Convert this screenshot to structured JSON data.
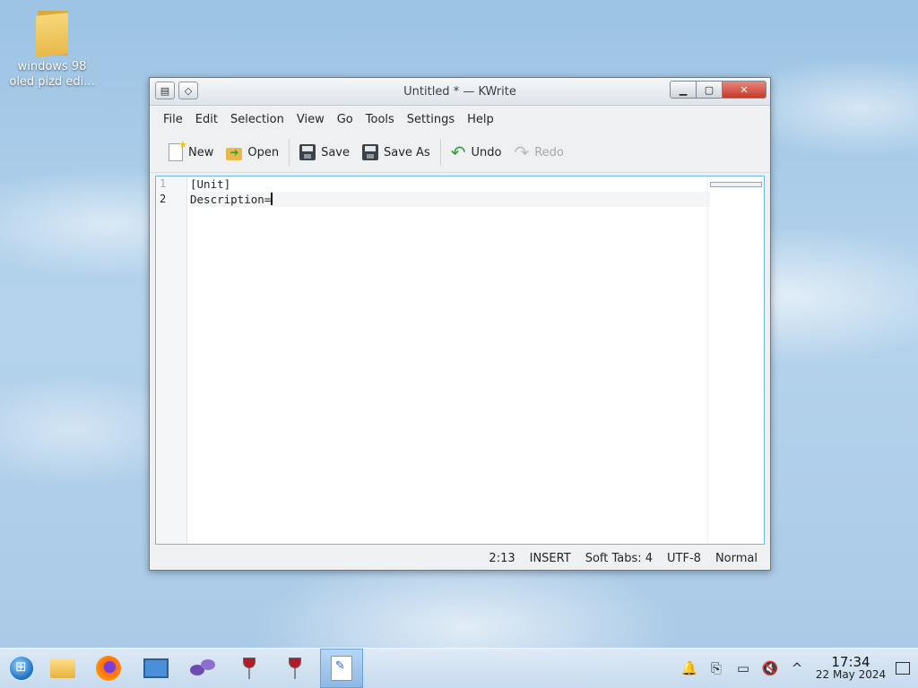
{
  "desktop": {
    "icon_label": "windows 98\noled pizd edi...",
    "icon_label_line1": "windows 98",
    "icon_label_line2": "oled pizd edi...",
    "icon": "folder-icon"
  },
  "window": {
    "title": "Untitled * — KWrite",
    "menu": [
      "File",
      "Edit",
      "Selection",
      "View",
      "Go",
      "Tools",
      "Settings",
      "Help"
    ],
    "toolbar": {
      "new": "New",
      "open": "Open",
      "save": "Save",
      "save_as": "Save As",
      "undo": "Undo",
      "redo": "Redo"
    },
    "editor": {
      "line_numbers": [
        "1",
        "2"
      ],
      "lines": [
        "[Unit]",
        "Description="
      ],
      "current_line": 2
    },
    "status": {
      "position": "2:13",
      "mode": "INSERT",
      "indent": "Soft Tabs: 4",
      "encoding": "UTF-8",
      "syntax": "Normal"
    }
  },
  "taskbar": {
    "apps": [
      "start-orb",
      "file-manager",
      "firefox",
      "remote-desktop",
      "kde-connect",
      "wine",
      "wine",
      "kwrite"
    ],
    "clock_time": "17:34",
    "clock_date": "22 May 2024"
  },
  "colors": {
    "accent": "#6fb6e8",
    "close_button": "#c43a2a",
    "taskbar": "#cfe0f1"
  }
}
